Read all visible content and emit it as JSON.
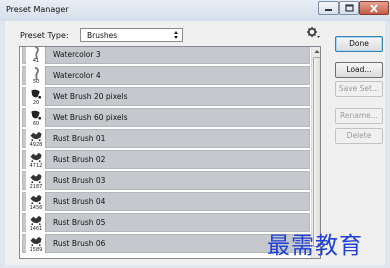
{
  "window": {
    "title": "Preset Manager"
  },
  "preset_type": {
    "label": "Preset Type:",
    "value": "Brushes"
  },
  "buttons": {
    "done": "Done",
    "load": "Load...",
    "save_set": "Save Set...",
    "rename": "Rename...",
    "delete": "Delete"
  },
  "presets": [
    {
      "size": "41",
      "name": "Watercolor 3",
      "icon": "watercolor-brush-icon"
    },
    {
      "size": "50",
      "name": "Watercolor 4",
      "icon": "watercolor-brush-icon"
    },
    {
      "size": "20",
      "name": "Wet Brush 20 pixels",
      "icon": "wet-brush-icon"
    },
    {
      "size": "60",
      "name": "Wet Brush 60 pixels",
      "icon": "wet-brush-icon"
    },
    {
      "size": "4928",
      "name": "Rust Brush 01",
      "icon": "rust-brush-icon"
    },
    {
      "size": "4712",
      "name": "Rust Brush 02",
      "icon": "rust-brush-icon"
    },
    {
      "size": "2187",
      "name": "Rust Brush 03",
      "icon": "rust-brush-icon"
    },
    {
      "size": "1456",
      "name": "Rust Brush 04",
      "icon": "rust-brush-icon"
    },
    {
      "size": "1461",
      "name": "Rust Brush 05",
      "icon": "rust-brush-icon"
    },
    {
      "size": "1589",
      "name": "Rust Brush 06",
      "icon": "rust-brush-icon"
    }
  ],
  "watermark": "最需教育",
  "colors": {
    "row_background": "#c5c8cc",
    "watermark": "#1f3fd6"
  }
}
